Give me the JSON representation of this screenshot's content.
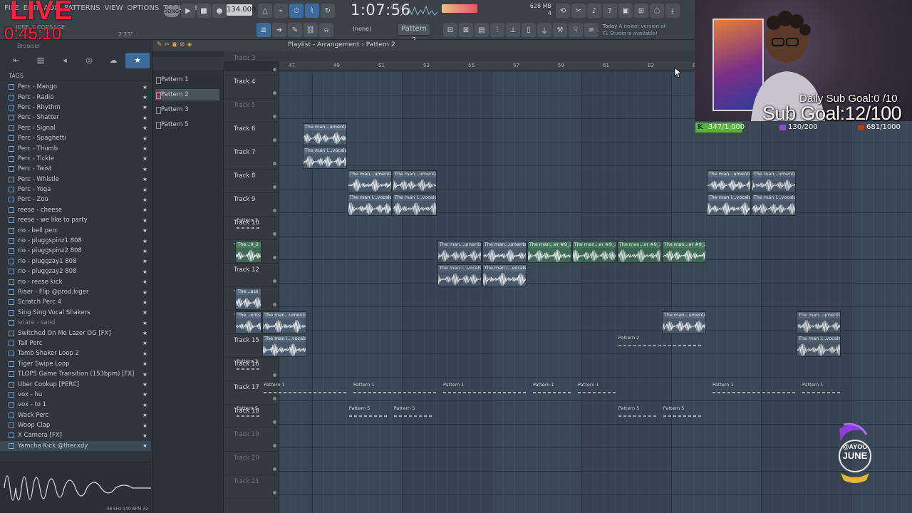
{
  "menu": [
    "FILE",
    "EDIT",
    "ADD",
    "PATTERNS",
    "VIEW",
    "OPTIONS",
    "TOOLS",
    "HELP"
  ],
  "overlay": {
    "live": "LIVE",
    "timer": "0:45:10",
    "song_label": "JUNE X CORSAGE",
    "daily_goal": "Daily Sub Goal:0  /10",
    "sub_goal": "Sub Goal:12/100",
    "kick_stat": "347/1,000",
    "twitch_stat": "130/200",
    "youtube_stat": "681/1000",
    "logo_text_1": "@AYOO",
    "logo_text_2": "JUNE"
  },
  "transport": {
    "mode": "SONG",
    "tempo": "134.000",
    "time": "1:07:56",
    "time_unit": "M:S:CS",
    "small_time": "2'23\"",
    "ram": "628 MB",
    "cpu": "4",
    "pattern": "Pattern 2",
    "snap": "(none)",
    "news_line1": "Today",
    "news_line2": "A newer version of",
    "news_line3": "FL Studio is available!"
  },
  "browser": {
    "title": "Browser",
    "tags": "TAGS",
    "items": [
      {
        "label": "Perc - Mango",
        "dim": false
      },
      {
        "label": "Perc - Radio",
        "dim": false
      },
      {
        "label": "Perc - Rhythm",
        "dim": false
      },
      {
        "label": "Perc - Shatter",
        "dim": false
      },
      {
        "label": "Perc - Signal",
        "dim": false
      },
      {
        "label": "Perc - Spaghetti",
        "dim": false
      },
      {
        "label": "Perc - Thumb",
        "dim": false
      },
      {
        "label": "Perc - Tickle",
        "dim": false
      },
      {
        "label": "Perc - Twist",
        "dim": false
      },
      {
        "label": "Perc - Whistle",
        "dim": false
      },
      {
        "label": "Perc - Yoga",
        "dim": false
      },
      {
        "label": "Perc - Zoo",
        "dim": false
      },
      {
        "label": "reese - cheese",
        "dim": false
      },
      {
        "label": "reese - we like to party",
        "dim": false
      },
      {
        "label": "rio - bell perc",
        "dim": false
      },
      {
        "label": "rio - pluggspinz1 808",
        "dim": false
      },
      {
        "label": "rio - pluggspinz2 808",
        "dim": false
      },
      {
        "label": "rio - pluggzay1 808",
        "dim": false
      },
      {
        "label": "rio - pluggzay2 808",
        "dim": false
      },
      {
        "label": "rio - reese kick",
        "dim": false
      },
      {
        "label": "Riser - Flip @prod.kiger",
        "dim": false
      },
      {
        "label": "Scratch Perc 4",
        "dim": false
      },
      {
        "label": "Sing Sing Vocal Shakers",
        "dim": false
      },
      {
        "label": "snare - sand",
        "dim": true
      },
      {
        "label": "Switched On Me Lazer OG [FX]",
        "dim": false
      },
      {
        "label": "Tail Perc",
        "dim": false
      },
      {
        "label": "Tamb Shaker Loop 2",
        "dim": false
      },
      {
        "label": "Tiger Swipe Loop",
        "dim": false
      },
      {
        "label": "TLOP5 Game Transition (153bpm) [FX]",
        "dim": false
      },
      {
        "label": "Uber Cookup [PERC]",
        "dim": false
      },
      {
        "label": "vox - hu",
        "dim": false
      },
      {
        "label": "vox - to 1",
        "dim": false
      },
      {
        "label": "Wack Perc",
        "dim": false
      },
      {
        "label": "Woop Clap",
        "dim": false
      },
      {
        "label": "X Camera [FX]",
        "dim": false
      },
      {
        "label": "Yamcha Kick @thecxdy",
        "dim": false
      }
    ],
    "wave_info": "48 kHz 140 BPM 32"
  },
  "patterns": [
    "Pattern 1",
    "Pattern 2",
    "Pattern 3",
    "Pattern 5"
  ],
  "playlist": {
    "title": "Playlist - Arrangement",
    "pattern": "Pattern 2",
    "ruler": [
      "47",
      "49",
      "51",
      "53",
      "55",
      "57",
      "59",
      "61",
      "63",
      "65",
      "67",
      "69",
      "71",
      "73",
      "75",
      "77",
      "79",
      "81"
    ],
    "tracks": [
      {
        "label": "Track 3",
        "dim": true
      },
      {
        "label": "Track 4",
        "dim": false
      },
      {
        "label": "Track 5",
        "dim": true
      },
      {
        "label": "Track 6",
        "dim": false
      },
      {
        "label": "Track 7",
        "dim": false
      },
      {
        "label": "Track 8",
        "dim": false
      },
      {
        "label": "Track 9",
        "dim": false
      },
      {
        "label": "Track 10",
        "dim": false
      },
      {
        "label": "Track 11",
        "dim": false
      },
      {
        "label": "Track 12",
        "dim": false
      },
      {
        "label": "Track 13",
        "dim": false
      },
      {
        "label": "Track 14",
        "dim": false
      },
      {
        "label": "Track 15",
        "dim": false
      },
      {
        "label": "Track 16",
        "dim": false
      },
      {
        "label": "Track 17",
        "dim": false
      },
      {
        "label": "Track 18",
        "dim": false
      },
      {
        "label": "Track 19",
        "dim": true
      },
      {
        "label": "Track 20",
        "dim": true
      },
      {
        "label": "Track 21",
        "dim": true
      }
    ],
    "clips": [
      {
        "track": 3,
        "bar": 47.5,
        "len": 2,
        "title": "The man...uments",
        "kind": "audio"
      },
      {
        "track": 4,
        "bar": 47.5,
        "len": 2,
        "title": "The man i...vocals",
        "kind": "audio"
      },
      {
        "track": 5,
        "bar": 49.5,
        "len": 2,
        "title": "The man...uments",
        "kind": "audio"
      },
      {
        "track": 5,
        "bar": 51.5,
        "len": 2,
        "title": "The man...uments",
        "kind": "audio"
      },
      {
        "track": 6,
        "bar": 49.5,
        "len": 2,
        "title": "The man i...vocals",
        "kind": "audio"
      },
      {
        "track": 6,
        "bar": 51.5,
        "len": 2,
        "title": "The man i...vocals",
        "kind": "audio"
      },
      {
        "track": 5,
        "bar": 65.5,
        "len": 2,
        "title": "The man...uments",
        "kind": "audio"
      },
      {
        "track": 5,
        "bar": 67.5,
        "len": 2,
        "title": "The man...uments",
        "kind": "audio"
      },
      {
        "track": 6,
        "bar": 65.5,
        "len": 2,
        "title": "The man i...vocals",
        "kind": "audio"
      },
      {
        "track": 6,
        "bar": 67.5,
        "len": 2,
        "title": "The man i...vocals",
        "kind": "audio"
      },
      {
        "track": 7,
        "bar": 44.5,
        "len": 1.2,
        "title": "Pattern 3",
        "kind": "pattern"
      },
      {
        "track": 8,
        "bar": 44.5,
        "len": 1.2,
        "title": "The...9_2",
        "kind": "green"
      },
      {
        "track": 8,
        "bar": 53.5,
        "len": 2,
        "title": "The man...uments",
        "kind": "audio"
      },
      {
        "track": 8,
        "bar": 55.5,
        "len": 2,
        "title": "The man...uments",
        "kind": "audio"
      },
      {
        "track": 8,
        "bar": 57.5,
        "len": 2,
        "title": "The man...er #9_2",
        "kind": "green"
      },
      {
        "track": 8,
        "bar": 59.5,
        "len": 2,
        "title": "The man...er #9_2",
        "kind": "green"
      },
      {
        "track": 8,
        "bar": 61.5,
        "len": 2,
        "title": "The man...er #9_2",
        "kind": "green"
      },
      {
        "track": 8,
        "bar": 63.5,
        "len": 2,
        "title": "The man...er #9_2",
        "kind": "green"
      },
      {
        "track": 9,
        "bar": 53.5,
        "len": 2,
        "title": "The man i...vocals",
        "kind": "audio"
      },
      {
        "track": 9,
        "bar": 55.5,
        "len": 2,
        "title": "The man i...vocals",
        "kind": "audio"
      },
      {
        "track": 10,
        "bar": 44.5,
        "len": 1.2,
        "title": "The...ass",
        "kind": "audio"
      },
      {
        "track": 11,
        "bar": 44.5,
        "len": 1.2,
        "title": "The...ents",
        "kind": "audio"
      },
      {
        "track": 11,
        "bar": 45.7,
        "len": 2,
        "title": "The man...uments",
        "kind": "audio"
      },
      {
        "track": 11,
        "bar": 63.5,
        "len": 2,
        "title": "The man...uments",
        "kind": "audio"
      },
      {
        "track": 11,
        "bar": 69.5,
        "len": 2,
        "title": "The man...uments",
        "kind": "audio"
      },
      {
        "track": 12,
        "bar": 45.7,
        "len": 2,
        "title": "The man i...vocals",
        "kind": "audio"
      },
      {
        "track": 12,
        "bar": 61.5,
        "len": 4,
        "title": "Pattern 2",
        "kind": "pattern"
      },
      {
        "track": 12,
        "bar": 69.5,
        "len": 2,
        "title": "The man i...vocals",
        "kind": "audio"
      },
      {
        "track": 13,
        "bar": 44.5,
        "len": 1.2,
        "title": "Pattern 3",
        "kind": "pattern"
      },
      {
        "track": 14,
        "bar": 45.7,
        "len": 4,
        "title": "Pattern 1",
        "kind": "pattern"
      },
      {
        "track": 14,
        "bar": 49.7,
        "len": 4,
        "title": "Pattern 1",
        "kind": "pattern"
      },
      {
        "track": 14,
        "bar": 53.7,
        "len": 4,
        "title": "Pattern 1",
        "kind": "pattern"
      },
      {
        "track": 14,
        "bar": 57.7,
        "len": 2,
        "title": "Pattern 1",
        "kind": "pattern"
      },
      {
        "track": 14,
        "bar": 59.7,
        "len": 2,
        "title": "Pattern 1",
        "kind": "pattern"
      },
      {
        "track": 14,
        "bar": 65.7,
        "len": 4,
        "title": "Pattern 1",
        "kind": "pattern"
      },
      {
        "track": 14,
        "bar": 69.7,
        "len": 2,
        "title": "Pattern 1",
        "kind": "pattern"
      },
      {
        "track": 15,
        "bar": 44.5,
        "len": 1.2,
        "title": "Pattern 5",
        "kind": "pattern"
      },
      {
        "track": 15,
        "bar": 49.5,
        "len": 2,
        "title": "Pattern 5",
        "kind": "pattern"
      },
      {
        "track": 15,
        "bar": 51.5,
        "len": 2,
        "title": "Pattern 5",
        "kind": "pattern"
      },
      {
        "track": 15,
        "bar": 61.5,
        "len": 2,
        "title": "Pattern 5",
        "kind": "pattern"
      },
      {
        "track": 15,
        "bar": 63.5,
        "len": 2,
        "title": "Pattern 5",
        "kind": "pattern"
      }
    ]
  },
  "colors": {
    "accent": "#3d6b9e",
    "live": "#ff1f3d",
    "clip": "#4b5a6a",
    "clip_green": "#3f6a53"
  }
}
